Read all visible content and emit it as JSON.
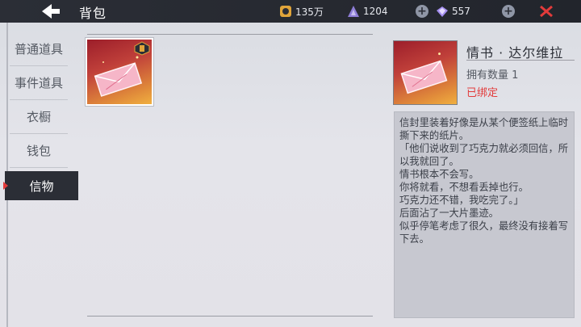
{
  "header": {
    "title": "背包",
    "resources": {
      "gold": "135万",
      "triangle": "1204",
      "diamond": "557"
    }
  },
  "sidebar": {
    "items": [
      {
        "label": "普通道具"
      },
      {
        "label": "事件道具"
      },
      {
        "label": "衣橱"
      },
      {
        "label": "钱包"
      },
      {
        "label": "信物"
      }
    ],
    "active": "信物"
  },
  "detail": {
    "name": "情书 · 达尔维拉",
    "quantity": "拥有数量 1",
    "status": "已绑定",
    "description": "信封里装着好像是从某个便签纸上临时撕下来的纸片。\n「他们说收到了巧克力就必须回信，所以我就回了。\n情书根本不会写。\n你将就看，不想看丢掉也行。\n巧克力还不错，我吃完了。」\n后面沾了一大片墨迹。\n似乎停笔考虑了很久，最终没有接着写下去。"
  },
  "colors": {
    "topbar": "#2b2e36",
    "accent_red": "#e23b3b",
    "item_card": "#c0403a"
  }
}
